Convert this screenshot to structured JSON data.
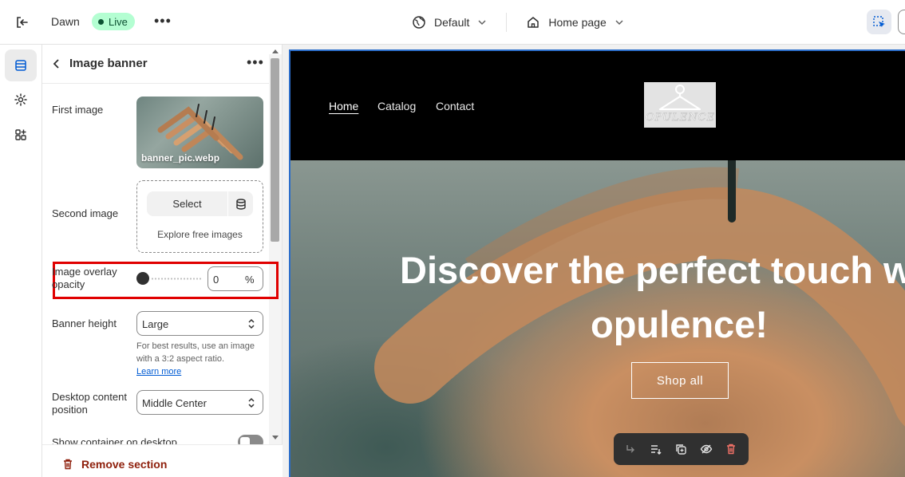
{
  "topbar": {
    "theme_name": "Dawn",
    "status_badge": "Live",
    "template_select": "Default",
    "page_select": "Home page"
  },
  "panel": {
    "title": "Image banner",
    "first_image": {
      "label": "First image",
      "filename": "banner_pic.webp"
    },
    "second_image": {
      "label": "Second image",
      "select_label": "Select",
      "explore_label": "Explore free images"
    },
    "overlay_opacity": {
      "label_line1": "Image overlay",
      "label_line2": "opacity",
      "value": "0",
      "unit": "%",
      "slider_fraction": 0
    },
    "banner_height": {
      "label": "Banner height",
      "value": "Large",
      "help_line1": "For best results, use an image",
      "help_line2": "with a 3:2 aspect ratio.",
      "help_link": "Learn more"
    },
    "desktop_content_position": {
      "label_line1": "Desktop content",
      "label_line2": "position",
      "value": "Middle Center"
    },
    "show_container": {
      "label": "Show container on desktop",
      "checked": false
    },
    "remove_section_label": "Remove section"
  },
  "preview": {
    "nav": [
      "Home",
      "Catalog",
      "Contact"
    ],
    "logo_text": "OPULENCE",
    "hero_line1": "Discover the perfect touch with",
    "hero_line2": "opulence!",
    "cta_label": "Shop all"
  },
  "colors": {
    "accent_blue": "#2c6ecb",
    "live_badge_bg": "#b4fed2",
    "highlight_red": "#e00000",
    "danger_text": "#8e1f0b"
  }
}
